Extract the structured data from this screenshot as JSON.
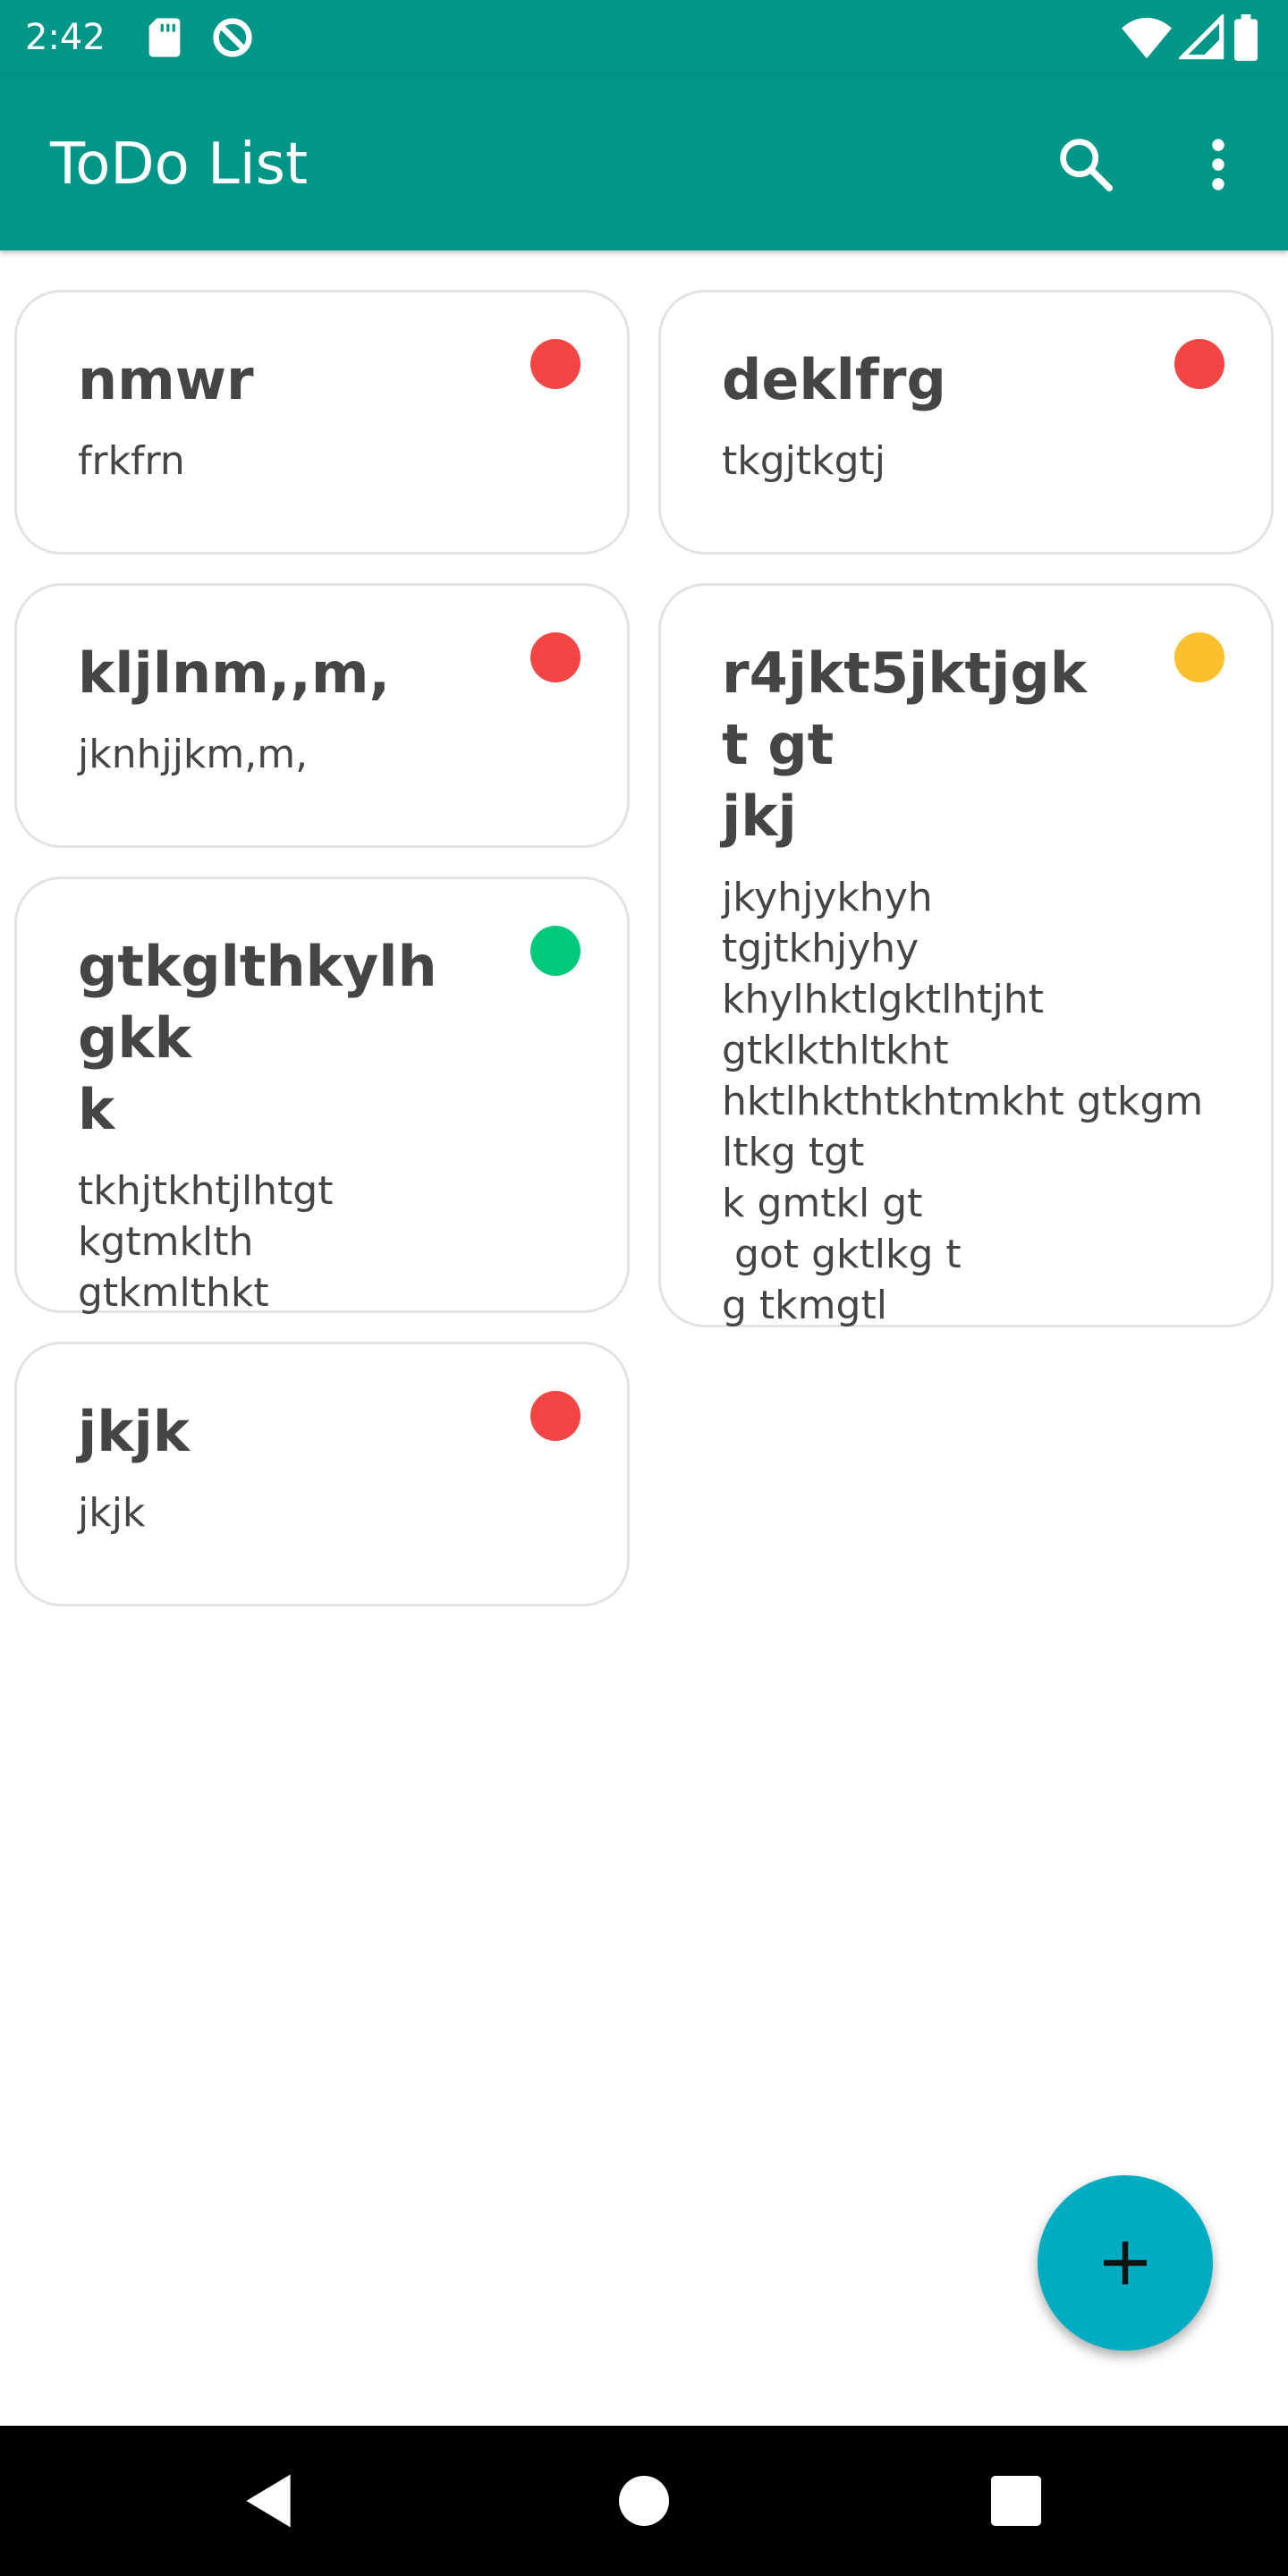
{
  "status_bar": {
    "time": "2:42",
    "left_icons": [
      "sd-card-icon",
      "data-saver-icon"
    ],
    "right_icons": [
      "wifi-icon",
      "cellular-signal-icon",
      "battery-icon"
    ]
  },
  "app_bar": {
    "title": "ToDo List",
    "actions": [
      "search-icon",
      "more-vert-icon"
    ],
    "background": "#009688"
  },
  "priority_colors": {
    "high": "#f44545",
    "medium": "#fbc02d",
    "low": "#00c97a"
  },
  "notes": [
    {
      "title": "nmwr",
      "body": "frkfrn",
      "priority": "high"
    },
    {
      "title": "deklfrg",
      "body": "tkgjtkgtj",
      "priority": "high"
    },
    {
      "title": "kljlnm,,m,",
      "body": "jknhjjkm,m,",
      "priority": "high"
    },
    {
      "title": "r4jkt5jktjgkt gt\njkj",
      "body": "jkyhjykhyh\ntgjtkhjyhy\nkhylhktlgktlhtjht\ngtklkthltkht\nhktlhkthtkhtmkht gtkgm\nltkg tgt\nk gmtkl gt\n got gktlkg t\ng tkmgtl",
      "priority": "medium"
    },
    {
      "title": "gtkglthkylhgkk\nk",
      "body": "tkhjtkhtjlhtgt\nkgtmklth\ngtkmlthkt",
      "priority": "low"
    },
    {
      "title": "jkjk",
      "body": "jkjk",
      "priority": "high"
    }
  ],
  "fab": {
    "icon": "add-icon",
    "color": "#00acc1"
  },
  "nav_bar": {
    "buttons": [
      "back-icon",
      "home-icon",
      "recents-icon"
    ]
  }
}
